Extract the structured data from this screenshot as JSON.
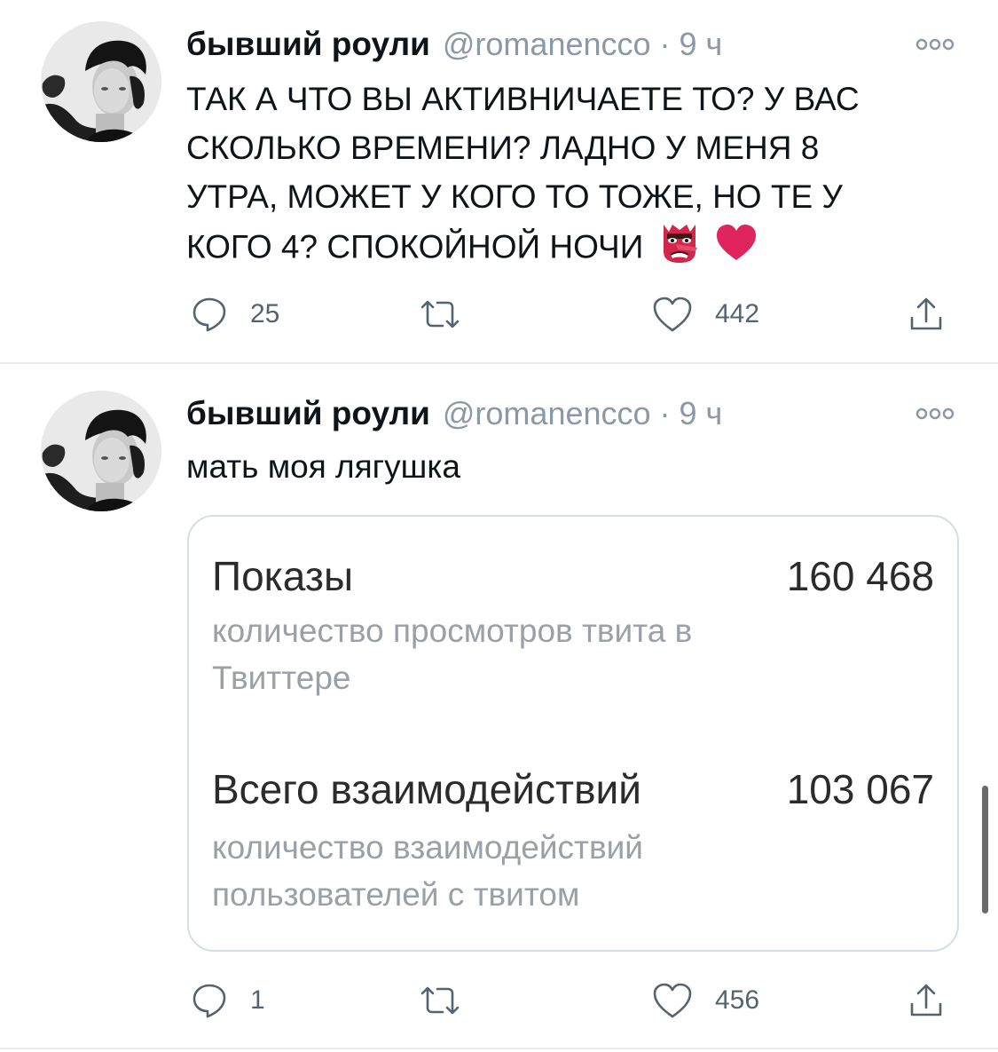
{
  "tweets": [
    {
      "display_name": "бывший роули",
      "handle": "@romanencco",
      "separator": "·",
      "time": "9 ч",
      "text_lines": [
        "ТАК А ЧТО ВЫ АКТИВНИЧАЕТЕ ТО? У ВАС",
        "СКОЛЬКО ВРЕМЕНИ? ЛАДНО У МЕНЯ 8",
        "УТРА, МОЖЕТ У КОГО ТО ТОЖЕ, НО ТЕ У",
        "КОГО 4? СПОКОЙНОЙ НОЧИ"
      ],
      "emojis": [
        "goblin-mask-emoji",
        "red-heart-emoji"
      ],
      "replies": "25",
      "retweets": "",
      "likes": "442"
    },
    {
      "display_name": "бывший роули",
      "handle": "@romanencco",
      "separator": "·",
      "time": "9 ч",
      "text": "мать моя лягушка",
      "media": {
        "metrics": [
          {
            "title": "Показы",
            "value": "160 468",
            "description_lines": [
              "количество просмотров твита в",
              "Твиттере"
            ]
          },
          {
            "title": "Всего взаимодействий",
            "value": "103 067",
            "description_lines": [
              "количество взаимодействий",
              "пользователей с твитом"
            ]
          }
        ]
      },
      "replies": "1",
      "retweets": "",
      "likes": "456"
    }
  ],
  "icons": {
    "reply": "reply-icon",
    "retweet": "retweet-icon",
    "like": "heart-icon",
    "share": "share-icon",
    "more": "more-icon"
  },
  "colors": {
    "text": "#0f1419",
    "secondary": "#8b98a5",
    "action": "#536471",
    "divider": "#e6ecf0",
    "card_border": "#d7dee3",
    "heart_emoji": "#e0245e"
  }
}
